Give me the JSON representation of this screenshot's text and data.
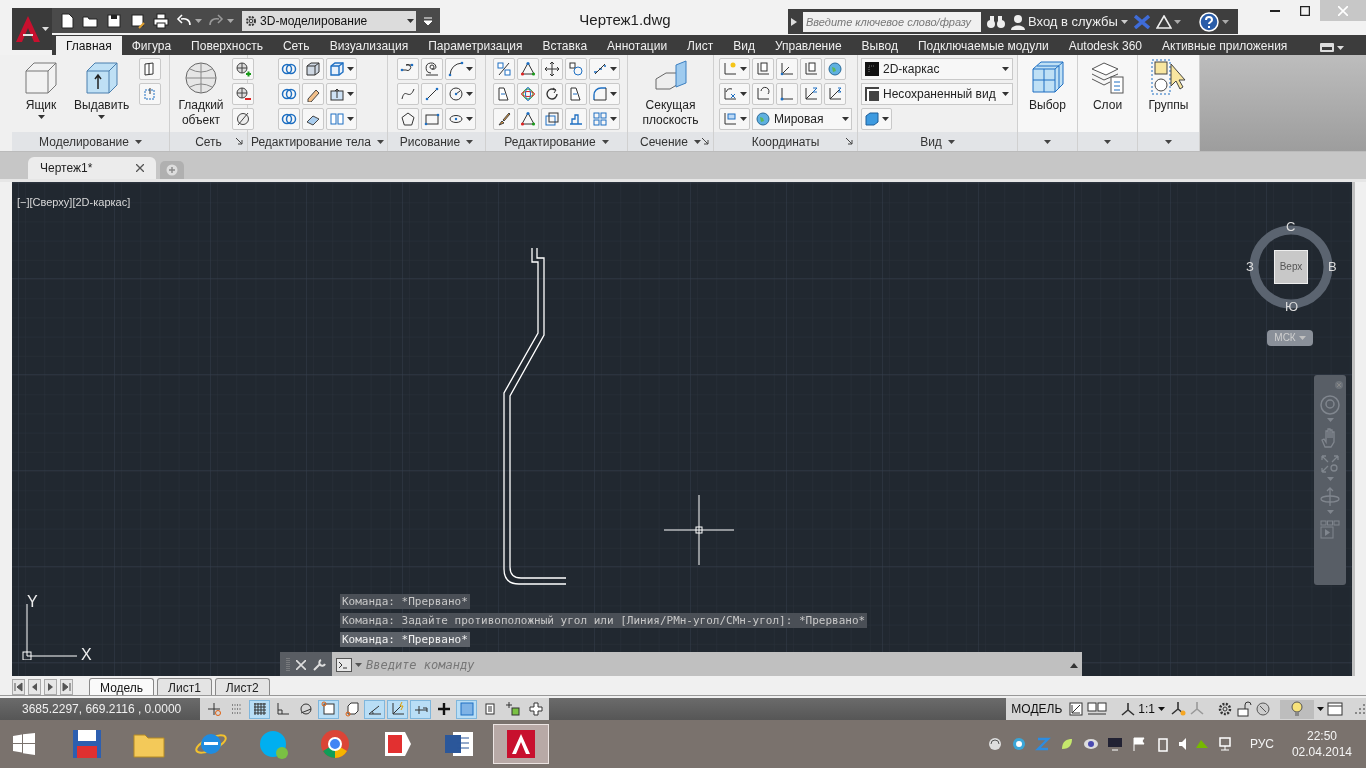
{
  "workspace": "3D-моделирование",
  "title": "Чертеж1.dwg",
  "search": {
    "placeholder": "Введите ключевое слово/фразу"
  },
  "sign_in": "Вход в службы",
  "ribbon_tabs": [
    {
      "label": "Главная",
      "selected": true
    },
    {
      "label": "Фигура",
      "selected": false
    },
    {
      "label": "Поверхность",
      "selected": false
    },
    {
      "label": "Сеть",
      "selected": false
    },
    {
      "label": "Визуализация",
      "selected": false
    },
    {
      "label": "Параметризация",
      "selected": false
    },
    {
      "label": "Вставка",
      "selected": false
    },
    {
      "label": "Аннотации",
      "selected": false
    },
    {
      "label": "Лист",
      "selected": false
    },
    {
      "label": "Вид",
      "selected": false
    },
    {
      "label": "Управление",
      "selected": false
    },
    {
      "label": "Вывод",
      "selected": false
    },
    {
      "label": "Подключаемые модули",
      "selected": false
    },
    {
      "label": "Autodesk 360",
      "selected": false
    },
    {
      "label": "Активные приложения",
      "selected": false
    }
  ],
  "ribbon_panels": [
    {
      "title": "Моделирование",
      "buttons": [
        "Ящик",
        "Выдавить"
      ]
    },
    {
      "title": "Сеть",
      "buttons": [
        "Гладкий объект"
      ]
    },
    {
      "title": "Редактирование тела"
    },
    {
      "title": "Рисование"
    },
    {
      "title": "Редактирование"
    },
    {
      "title": "Сечение",
      "buttons": [
        "Секущая плоскость"
      ]
    },
    {
      "title": "Координаты",
      "dropdown": "Мировая"
    },
    {
      "title": "Вид",
      "dropdowns": [
        "2D-каркас",
        "Несохраненный вид"
      ]
    },
    {
      "buttons": [
        "Выбор"
      ]
    },
    {
      "buttons": [
        "Слои"
      ]
    },
    {
      "buttons": [
        "Группы"
      ]
    }
  ],
  "file_tabs": [
    {
      "label": "Чертеж1*",
      "selected": true
    }
  ],
  "viewport": {
    "label": "[−][Сверху][2D-каркас]",
    "viewcube": {
      "north": "С",
      "west": "З",
      "east": "В",
      "south": "Ю",
      "face": "Верх",
      "ucs": "МСК"
    },
    "ucs_axes": {
      "x": "X",
      "y": "Y"
    }
  },
  "command_history": [
    "Команда: *Прервано*",
    "Команда: Задайте противоположный угол или [Линия/РМн-угол/СМн-угол]: *Прервано*",
    "Команда: *Прервано*"
  ],
  "command_line": {
    "placeholder": "Введите команду"
  },
  "layout_tabs": [
    {
      "label": "Модель",
      "selected": true
    },
    {
      "label": "Лист1",
      "selected": false
    },
    {
      "label": "Лист2",
      "selected": false
    }
  ],
  "status_bar": {
    "coordinates": "3685.2297, 669.2116 , 0.0000",
    "toggles": [
      {
        "on": false
      },
      {
        "on": false
      },
      {
        "on": true
      },
      {
        "on": false
      },
      {
        "on": false
      },
      {
        "on": true
      },
      {
        "on": false
      },
      {
        "on": true
      },
      {
        "on": true
      },
      {
        "on": true
      },
      {
        "on": false
      },
      {
        "on": true
      },
      {
        "on": false
      },
      {
        "on": false
      },
      {
        "on": false
      }
    ],
    "space": "МОДЕЛЬ",
    "scale": "1:1"
  },
  "taskbar": {
    "apps": [
      {
        "selected": false
      },
      {
        "selected": false
      },
      {
        "selected": false
      },
      {
        "selected": false
      },
      {
        "selected": false
      },
      {
        "selected": false
      },
      {
        "selected": false
      },
      {
        "selected": true
      }
    ],
    "language": "РУС",
    "time": "22:50",
    "date": "02.04.2014"
  }
}
